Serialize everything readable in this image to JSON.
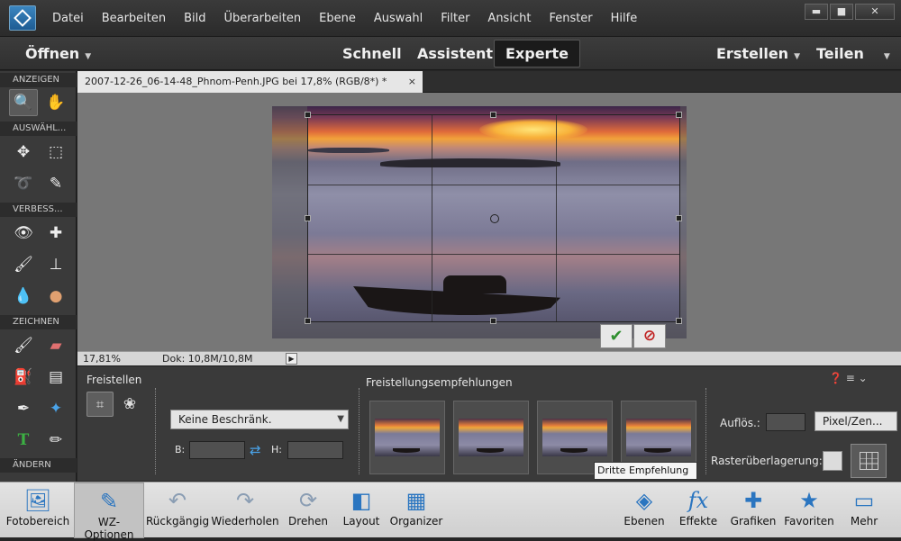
{
  "menu": [
    "Datei",
    "Bearbeiten",
    "Bild",
    "Überarbeiten",
    "Ebene",
    "Auswahl",
    "Filter",
    "Ansicht",
    "Fenster",
    "Hilfe"
  ],
  "window_controls": {
    "minimize": "▬",
    "maximize": "■",
    "close": "✕"
  },
  "topbar": {
    "open": "Öffnen",
    "modes": [
      "Schnell",
      "Assistent",
      "Experte"
    ],
    "active_mode": "Experte",
    "create": "Erstellen",
    "share": "Teilen"
  },
  "toolbox": {
    "sections": [
      "ANZEIGEN",
      "AUSWÄHL...",
      "VERBESS...",
      "ZEICHNEN",
      "ÄNDERN"
    ]
  },
  "document": {
    "tab_title": "2007-12-26_06-14-48_Phnom-Penh.JPG bei 17,8% (RGB/8*) *",
    "close": "×"
  },
  "status": {
    "zoom": "17,81%",
    "doc_size": "Dok: 10,8M/10,8M"
  },
  "options": {
    "tool_label": "Freistellen",
    "preset": "Keine Beschränk.",
    "width_label": "B:",
    "height_label": "H:",
    "suggestions_label": "Freistellungsempfehlungen",
    "tooltip": "Dritte Empfehlung",
    "resolution_label": "Auflös.:",
    "unit": "Pixel/Zen...",
    "grid_label": "Rasterüberlagerung:"
  },
  "bottombar": [
    {
      "label": "Fotobereich",
      "icon": "photo-bin-icon"
    },
    {
      "label": "WZ-Optionen",
      "icon": "tool-options-icon",
      "active": true
    },
    {
      "label": "Rückgängig",
      "icon": "undo-icon"
    },
    {
      "label": "Wiederholen",
      "icon": "redo-icon"
    },
    {
      "label": "Drehen",
      "icon": "rotate-icon"
    },
    {
      "label": "Layout",
      "icon": "layout-icon"
    },
    {
      "label": "Organizer",
      "icon": "organizer-icon"
    },
    {
      "label": "Ebenen",
      "icon": "layers-icon"
    },
    {
      "label": "Effekte",
      "icon": "effects-icon"
    },
    {
      "label": "Grafiken",
      "icon": "graphics-icon"
    },
    {
      "label": "Favoriten",
      "icon": "favorites-icon"
    },
    {
      "label": "Mehr",
      "icon": "more-icon"
    }
  ],
  "colors": {
    "accent": "#2a75c0",
    "confirm": "#2f8f2f",
    "cancel": "#c02020"
  }
}
